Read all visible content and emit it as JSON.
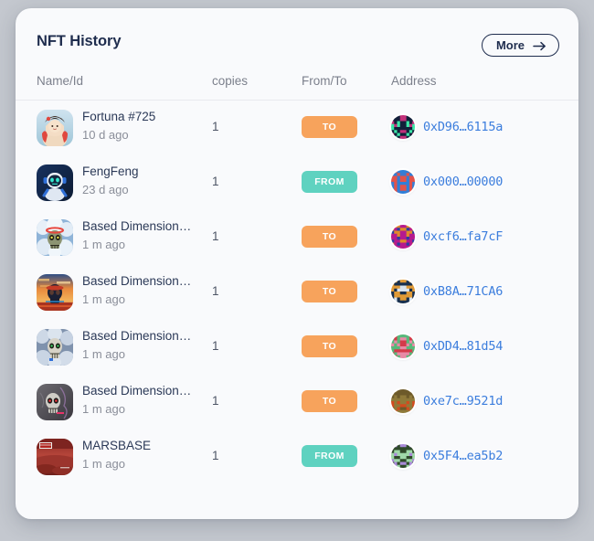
{
  "card": {
    "title": "NFT History",
    "more_label": "More",
    "more_icon": "arrow-right-icon"
  },
  "columns": {
    "name": "Name/Id",
    "copies": "copies",
    "fromto": "From/To",
    "address": "Address"
  },
  "colors": {
    "page_background": "#c4c8cf",
    "card_background": "#f9fafc",
    "title": "#1f2d4e",
    "column_header": "#7c808c",
    "nft_name": "#2b3957",
    "nft_time": "#8a8e99",
    "badge_to": "#f7a35c",
    "badge_from": "#5fd2c0",
    "address_link": "#3b7ddd",
    "divider": "#e8eaef"
  },
  "rows": [
    {
      "name": "Fortuna #725",
      "time": "10 d ago",
      "copies": "1",
      "direction": "TO",
      "direction_kind": "to",
      "address": "0xD96…6115a",
      "thumb_icon": "nft-thumbnail-fortuna",
      "avatar_icon": "address-blockie-icon"
    },
    {
      "name": "FengFeng",
      "time": "23 d ago",
      "copies": "1",
      "direction": "FROM",
      "direction_kind": "from",
      "address": "0x000…00000",
      "thumb_icon": "nft-thumbnail-fengfeng",
      "avatar_icon": "address-blockie-icon"
    },
    {
      "name": "Based Dimension…",
      "time": "1 m ago",
      "copies": "1",
      "direction": "TO",
      "direction_kind": "to",
      "address": "0xcf6…fa7cF",
      "thumb_icon": "nft-thumbnail-based-clouds-skull",
      "avatar_icon": "address-blockie-icon"
    },
    {
      "name": "Based Dimension…",
      "time": "1 m ago",
      "copies": "1",
      "direction": "TO",
      "direction_kind": "to",
      "address": "0xB8A…71CA6",
      "thumb_icon": "nft-thumbnail-based-sunset",
      "avatar_icon": "address-blockie-icon"
    },
    {
      "name": "Based Dimension…",
      "time": "1 m ago",
      "copies": "1",
      "direction": "TO",
      "direction_kind": "to",
      "address": "0xDD4…81d54",
      "thumb_icon": "nft-thumbnail-based-grey-skull",
      "avatar_icon": "address-blockie-icon"
    },
    {
      "name": "Based Dimension…",
      "time": "1 m ago",
      "copies": "1",
      "direction": "TO",
      "direction_kind": "to",
      "address": "0xe7c…9521d",
      "thumb_icon": "nft-thumbnail-based-dark-skull",
      "avatar_icon": "address-blockie-icon"
    },
    {
      "name": "MARSBASE",
      "time": "1 m ago",
      "copies": "1",
      "direction": "FROM",
      "direction_kind": "from",
      "address": "0x5F4…ea5b2",
      "thumb_icon": "nft-thumbnail-marsbase",
      "avatar_icon": "address-blockie-icon"
    }
  ]
}
